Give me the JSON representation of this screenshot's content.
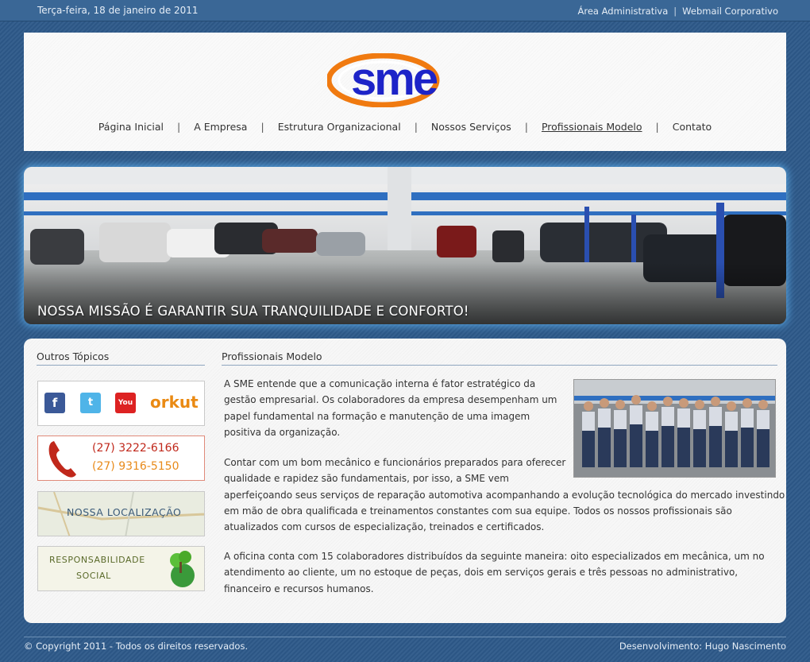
{
  "topbar": {
    "date": "Terça-feira, 18 de janeiro de 2011",
    "admin_link": "Área Administrativa",
    "separator": "|",
    "webmail_link": "Webmail Corporativo"
  },
  "header": {
    "logo_text": "sme",
    "nav": [
      "Página Inicial",
      "A Empresa",
      "Estrutura Organizacional",
      "Nossos Serviços",
      "Profissionais Modelo",
      "Contato"
    ],
    "nav_separator": "|",
    "active_item": "Profissionais Modelo"
  },
  "banner": {
    "caption": "NOSSA MISSÃO É GARANTIR SUA TRANQUILIDADE E CONFORTO!"
  },
  "sidebar": {
    "title": "Outros Tópicos",
    "social": {
      "facebook_glyph": "f",
      "twitter_glyph": "t",
      "youtube_glyph": "You Tube",
      "orkut_label": "orkut"
    },
    "phone": {
      "number_1": "(27) 3222-6166",
      "number_2": "(27) 9316-5150"
    },
    "location_label": "NOSSA LOCALIZAÇÃO",
    "responsibility_label_1": "RESPONSABILIDADE",
    "responsibility_label_2": "SOCIAL"
  },
  "main": {
    "title": "Profissionais Modelo",
    "p1_lines": [
      "A SME entende que a comunicação interna é fator estratégico da",
      "gestão empresarial. Os colaboradores da empresa desempenham um",
      "papel fundamental na formação e manutenção de uma imagem",
      "positiva da organização."
    ],
    "p2_lines": [
      "Contar com um bom mecânico e funcionários preparados para oferecer",
      "qualidade e rapidez são fundamentais, por isso, a SME vem",
      "aperfeiçoando seus serviços de reparação automotiva acompanhando a evolução tecnológica do mercado investindo",
      "em mão de obra qualificada e treinamentos constantes com sua equipe. Todos os nossos profissionais são",
      "atualizados com cursos de especialização, treinados e certificados."
    ],
    "p3_lines": [
      "A oficina conta com 15 colaboradores distribuídos da seguinte maneira: oito especializados em mecânica, um no",
      "atendimento ao cliente, um no estoque de peças, dois em serviços gerais e três pessoas no administrativo,",
      "financeiro e recursos humanos."
    ]
  },
  "footer": {
    "copyright": "© Copyright 2011 - Todos os direitos reservados.",
    "credit": "Desenvolvimento: Hugo Nascimento"
  },
  "colors": {
    "page_bg": "#2e5a8a",
    "logo_blue": "#1d24c8",
    "logo_orange": "#f07a10",
    "phone_red": "#c0281b",
    "phone_orange": "#e88a1a",
    "banner_glow": "#64beff"
  }
}
